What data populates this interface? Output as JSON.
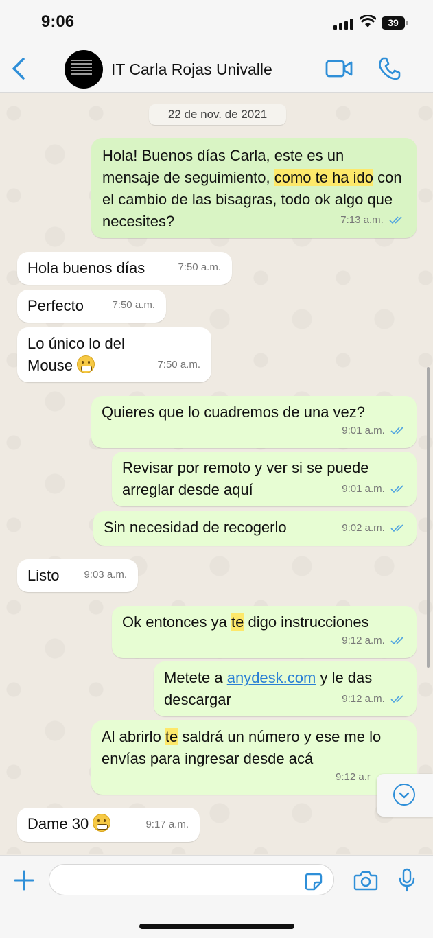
{
  "status_bar": {
    "time": "9:06",
    "battery": "39"
  },
  "header": {
    "back_icon": "chevron-left-icon",
    "contact_name": "IT Carla Rojas Univalle",
    "video_icon": "video-camera-icon",
    "call_icon": "phone-icon"
  },
  "chat": {
    "date_chip": "22 de nov. de 2021",
    "messages": [
      {
        "direction": "out",
        "parts": [
          "Hola! Buenos días Carla, este es un mensaje de seguimiento, ",
          "como te ha ido",
          " con el cambio de las bisagras, todo ok algo que necesites?"
        ],
        "time": "7:13 a.m."
      },
      {
        "direction": "in",
        "text": "Hola buenos días",
        "time": "7:50 a.m."
      },
      {
        "direction": "in",
        "text": "Perfecto",
        "time": "7:50 a.m."
      },
      {
        "direction": "in",
        "text": "Lo único lo del Mouse",
        "time": "7:50 a.m."
      },
      {
        "direction": "out",
        "text": "Quieres que lo cuadremos de una vez?",
        "time": "9:01 a.m."
      },
      {
        "direction": "out",
        "text": "Revisar por remoto y ver si se puede arreglar desde aquí",
        "time": "9:01 a.m."
      },
      {
        "direction": "out",
        "text": "Sin necesidad de recogerlo",
        "time": "9:02 a.m."
      },
      {
        "direction": "in",
        "text": "Listo",
        "time": "9:03 a.m."
      },
      {
        "direction": "out",
        "parts": [
          "Ok entonces ya ",
          "te",
          " digo instrucciones"
        ],
        "time": "9:12 a.m."
      },
      {
        "direction": "out",
        "parts": [
          "Metete a ",
          "anydesk.com",
          " y le das descargar"
        ],
        "time": "9:12 a.m."
      },
      {
        "direction": "out",
        "parts": [
          "Al abrirlo ",
          "te",
          " saldrá un número y ese me lo envías para ingresar desde acá"
        ],
        "time": "9:12 a.r"
      },
      {
        "direction": "in",
        "text": "Dame 30",
        "time": "9:17 a.m."
      }
    ]
  },
  "composer": {
    "add_icon": "plus-icon",
    "sticker_icon": "sticker-icon",
    "camera_icon": "camera-icon",
    "mic_icon": "microphone-icon",
    "scroll_icon": "chevron-down-circle-icon"
  },
  "colors": {
    "accent": "#2f8fd8",
    "outgoing": "#e7fdd3",
    "incoming": "#ffffff",
    "highlight": "#fde86a",
    "background": "#efeae2"
  }
}
